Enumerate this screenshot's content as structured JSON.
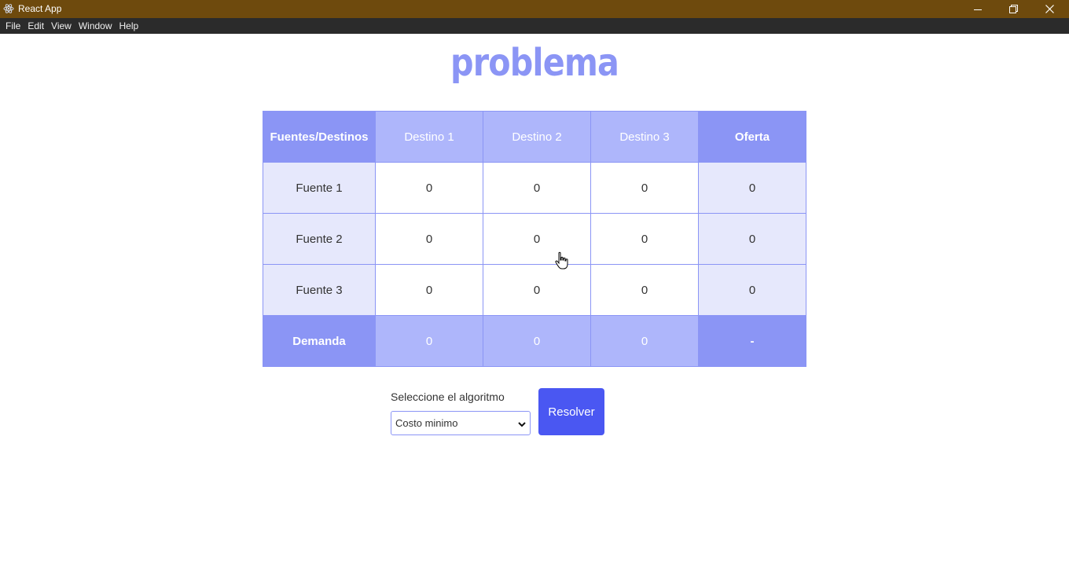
{
  "window": {
    "title": "React App"
  },
  "menu": {
    "items": [
      "File",
      "Edit",
      "View",
      "Window",
      "Help"
    ]
  },
  "page": {
    "title": "problema"
  },
  "table": {
    "corner_header": "Fuentes/Destinos",
    "destinations": [
      "Destino 1",
      "Destino 2",
      "Destino 3"
    ],
    "supply_header": "Oferta",
    "rows": [
      {
        "label": "Fuente 1",
        "costs": [
          "0",
          "0",
          "0"
        ],
        "supply": "0"
      },
      {
        "label": "Fuente 2",
        "costs": [
          "0",
          "0",
          "0"
        ],
        "supply": "0"
      },
      {
        "label": "Fuente 3",
        "costs": [
          "0",
          "0",
          "0"
        ],
        "supply": "0"
      }
    ],
    "demand": {
      "label": "Demanda",
      "values": [
        "0",
        "0",
        "0"
      ],
      "total": "-"
    }
  },
  "controls": {
    "algorithm_label": "Seleccione el algoritmo",
    "algorithm_selected": "Costo minimo",
    "solve_label": "Resolver"
  },
  "colors": {
    "titlebar": "#6e4a0d",
    "menubar": "#2b2b2b",
    "accent": "#8b95f5",
    "accent_light": "#aeb6fb",
    "row_tint": "#e6e8fc",
    "button": "#4a57f2"
  },
  "icons": {
    "app": "react-atom-icon",
    "minimize": "minimize-icon",
    "maximize": "restore-icon",
    "close": "close-icon",
    "select": "chevron-down-icon",
    "cursor": "hand-pointer-icon"
  }
}
